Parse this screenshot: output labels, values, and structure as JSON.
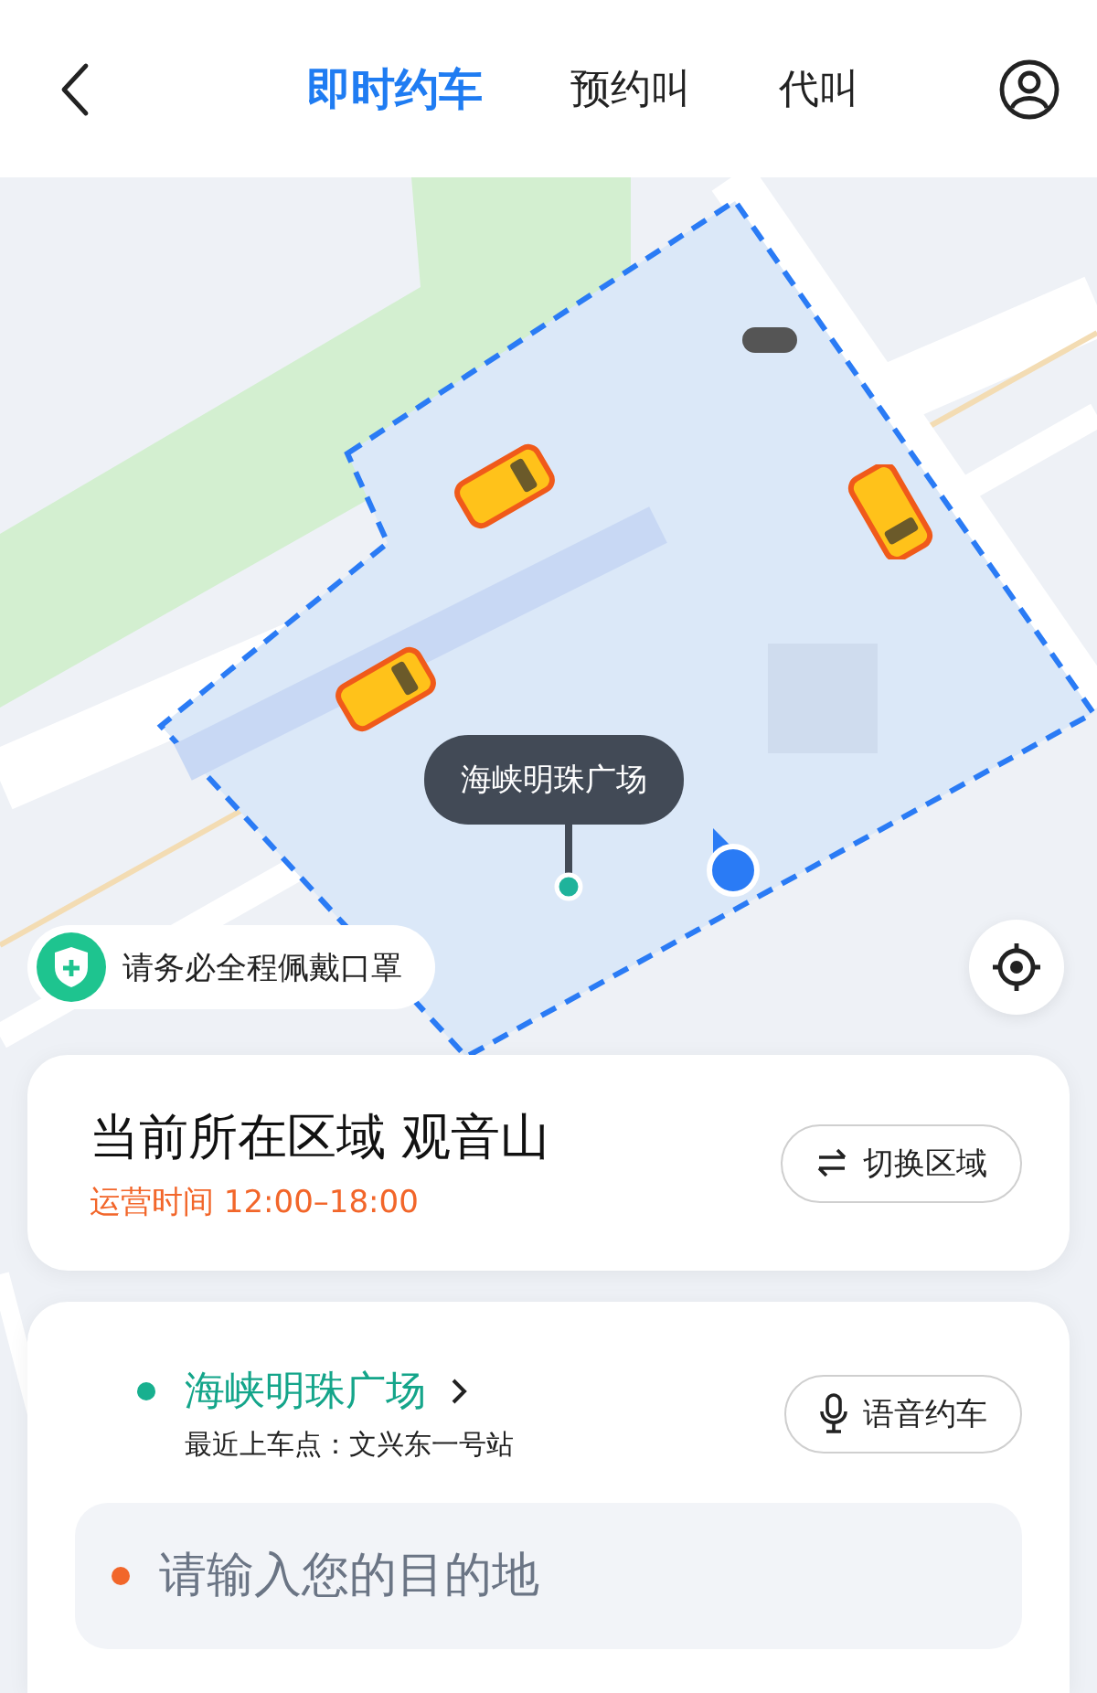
{
  "tabs": [
    {
      "label": "即时约车",
      "selected": true
    },
    {
      "label": "预约叫",
      "selected": false
    },
    {
      "label": "代叫",
      "selected": false
    }
  ],
  "map": {
    "kind": "picture",
    "callout": "海峡明珠广场"
  },
  "notice": {
    "text": "请务必全程佩戴口罩"
  },
  "region": {
    "title": "当前所在区域 观音山",
    "hours": "运营时间 12:00–18:00",
    "switch_button": "切换区域"
  },
  "pickup": {
    "name": "海峡明珠广场",
    "hint": "最近上车点：文兴东一号站",
    "voice_button": "语音约车"
  },
  "destination": {
    "placeholder": "请输入您的目的地"
  }
}
